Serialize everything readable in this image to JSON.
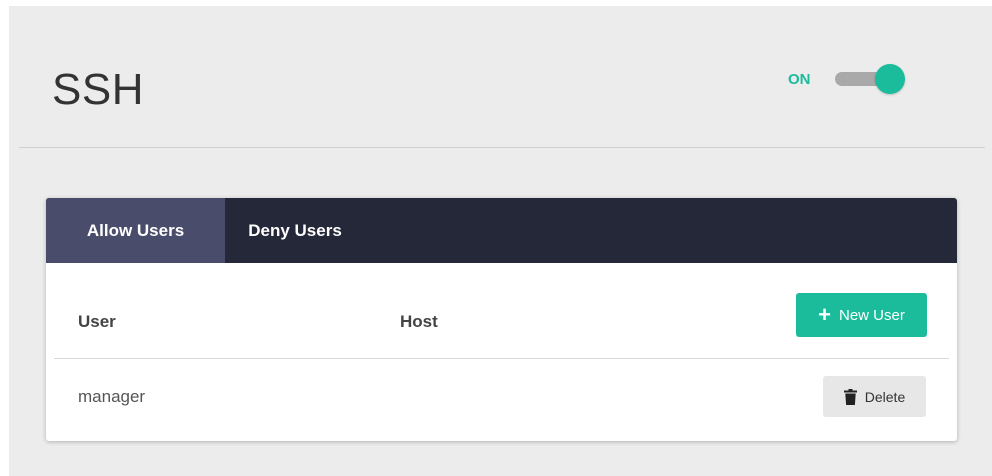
{
  "page": {
    "title": "SSH"
  },
  "toggle": {
    "label": "ON",
    "state": "on",
    "accent_color": "#1abc9c"
  },
  "tabs": [
    {
      "label": "Allow Users",
      "active": true
    },
    {
      "label": "Deny Users",
      "active": false
    }
  ],
  "table": {
    "columns": [
      "User",
      "Host"
    ],
    "new_button": {
      "label": "New User",
      "icon": "plus-icon"
    },
    "rows": [
      {
        "user": "manager",
        "host": "",
        "action_label": "Delete",
        "action_icon": "trash-icon"
      }
    ]
  },
  "colors": {
    "accent": "#1abc9c",
    "tabbar": "#252838",
    "tab_active": "#4a4c6b"
  }
}
